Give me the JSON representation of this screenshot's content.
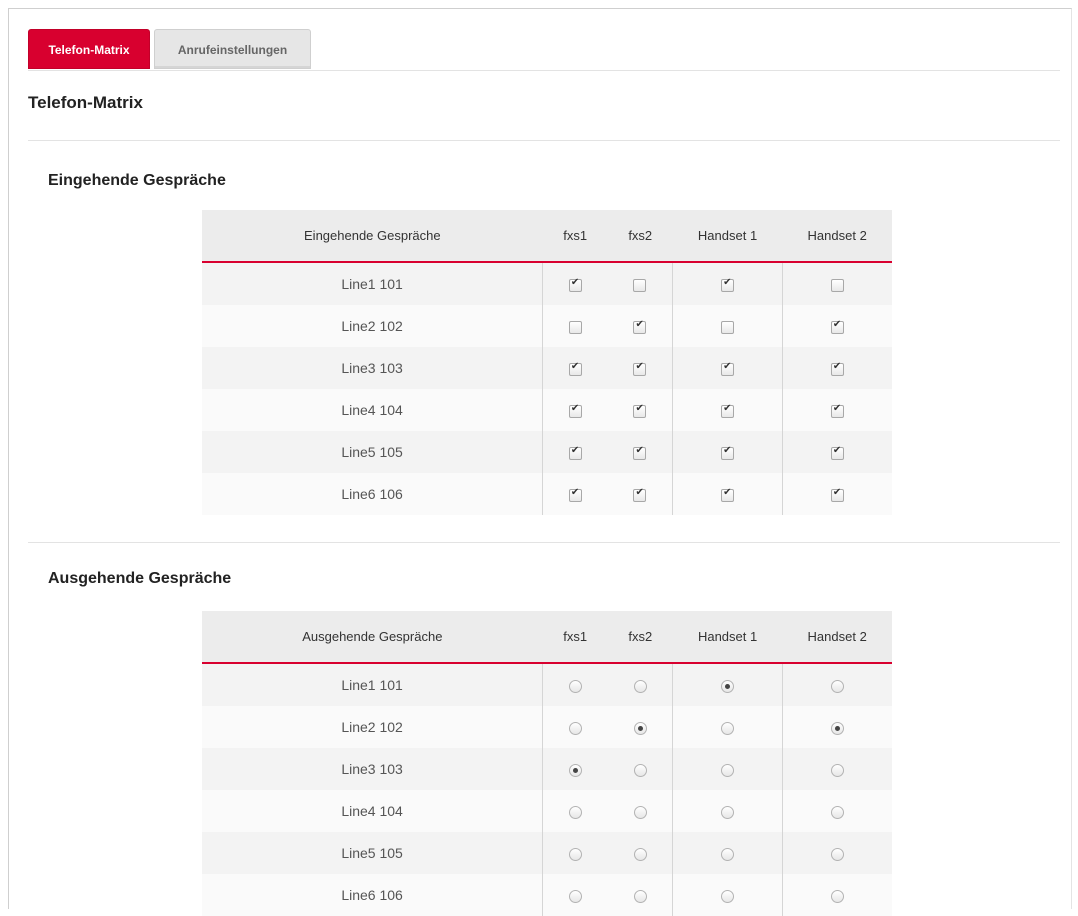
{
  "tabs": [
    {
      "label": "Telefon-Matrix",
      "active": true
    },
    {
      "label": "Anrufeinstellungen",
      "active": false
    }
  ],
  "page_title": "Telefon-Matrix",
  "incoming": {
    "title": "Eingehende Gespräche",
    "headers": [
      "Eingehende Gespräche",
      "fxs1",
      "fxs2",
      "Handset 1",
      "Handset 2"
    ],
    "rows": [
      {
        "label": "Line1 101",
        "values": [
          true,
          false,
          true,
          false
        ]
      },
      {
        "label": "Line2 102",
        "values": [
          false,
          true,
          false,
          true
        ]
      },
      {
        "label": "Line3 103",
        "values": [
          true,
          true,
          true,
          true
        ]
      },
      {
        "label": "Line4 104",
        "values": [
          true,
          true,
          true,
          true
        ]
      },
      {
        "label": "Line5 105",
        "values": [
          true,
          true,
          true,
          true
        ]
      },
      {
        "label": "Line6 106",
        "values": [
          true,
          true,
          true,
          true
        ]
      }
    ]
  },
  "outgoing": {
    "title": "Ausgehende Gespräche",
    "headers": [
      "Ausgehende Gespräche",
      "fxs1",
      "fxs2",
      "Handset 1",
      "Handset 2"
    ],
    "rows": [
      {
        "label": "Line1 101",
        "values": [
          false,
          false,
          true,
          false
        ]
      },
      {
        "label": "Line2 102",
        "values": [
          false,
          true,
          false,
          true
        ]
      },
      {
        "label": "Line3 103",
        "values": [
          true,
          false,
          false,
          false
        ]
      },
      {
        "label": "Line4 104",
        "values": [
          false,
          false,
          false,
          false
        ]
      },
      {
        "label": "Line5 105",
        "values": [
          false,
          false,
          false,
          false
        ]
      },
      {
        "label": "Line6 106",
        "values": [
          false,
          false,
          false,
          false
        ]
      }
    ]
  },
  "colors": {
    "accent": "#d8002f",
    "header_bg": "#ececec",
    "row_odd": "#f3f3f3",
    "row_even": "#fafafa"
  }
}
